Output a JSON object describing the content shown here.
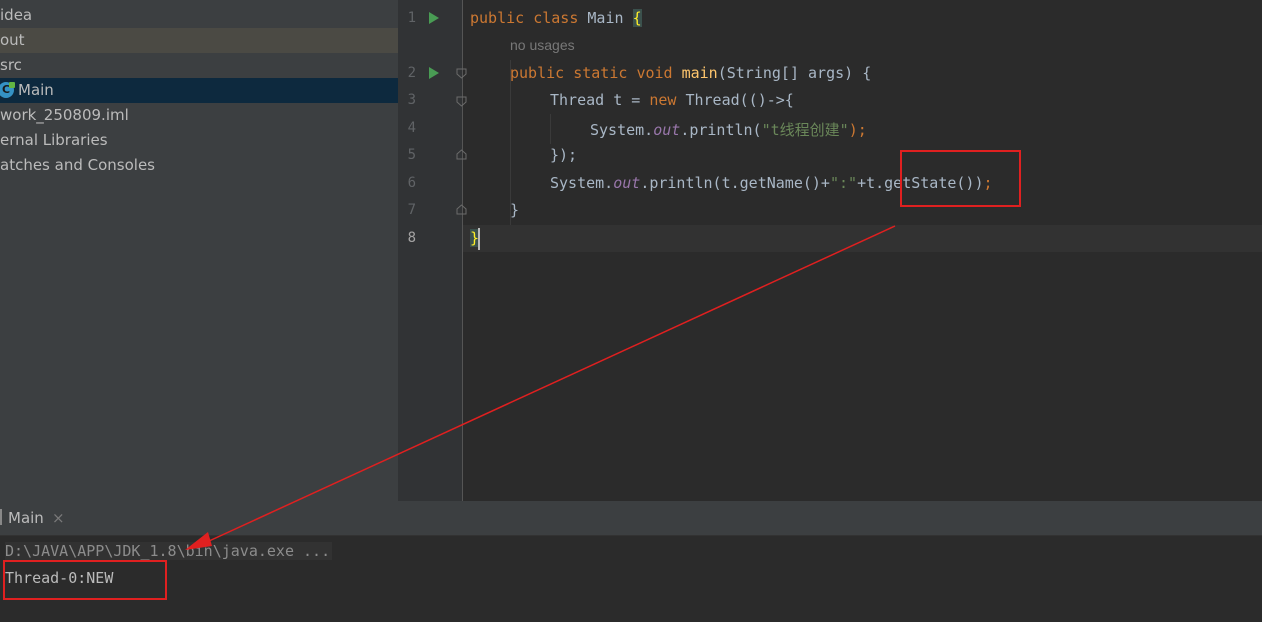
{
  "project_tree": {
    "items": [
      {
        "label": "idea"
      },
      {
        "label": "out"
      },
      {
        "label": "src"
      },
      {
        "label": "Main"
      },
      {
        "label": "work_250809.iml"
      },
      {
        "label": "ernal Libraries"
      },
      {
        "label": "atches and Consoles"
      }
    ],
    "class_icon_glyph": "C"
  },
  "editor": {
    "line_numbers": [
      "1",
      "2",
      "3",
      "4",
      "5",
      "6",
      "7",
      "8"
    ],
    "usage_hint": "no usages",
    "code": {
      "l1_kw1": "public",
      "l1_kw2": "class",
      "l1_name": "Main",
      "l1_brace": "{",
      "l2_kw1": "public",
      "l2_kw2": "static",
      "l2_kw3": "void",
      "l2_fn": "main",
      "l2_rest": "(String[] args) {",
      "l3_type": "Thread",
      "l3_var": "t",
      "l3_eq": "=",
      "l3_new": "new",
      "l3_rest": "Thread(()->{",
      "l4_sys": "System.",
      "l4_out": "out",
      "l4_call": ".println(",
      "l4_str": "\"t线程创建\"",
      "l4_end": ");",
      "l5": "});",
      "l6_sys": "System.",
      "l6_out": "out",
      "l6_call": ".println(t.getName()+",
      "l6_str": "\":\"",
      "l6_rest": "+t.getState())",
      "l6_end": ";",
      "l7": "}",
      "l8": "}"
    }
  },
  "run_panel": {
    "tab_label": "Main",
    "close_glyph": "×",
    "command_line": "D:\\JAVA\\APP\\JDK_1.8\\bin\\java.exe ...",
    "output": "Thread-0:NEW"
  },
  "colors": {
    "annotation_red": "#e02020",
    "keyword": "#cc7832",
    "string": "#6a8759",
    "method": "#ffc66d",
    "field": "#9876aa"
  }
}
